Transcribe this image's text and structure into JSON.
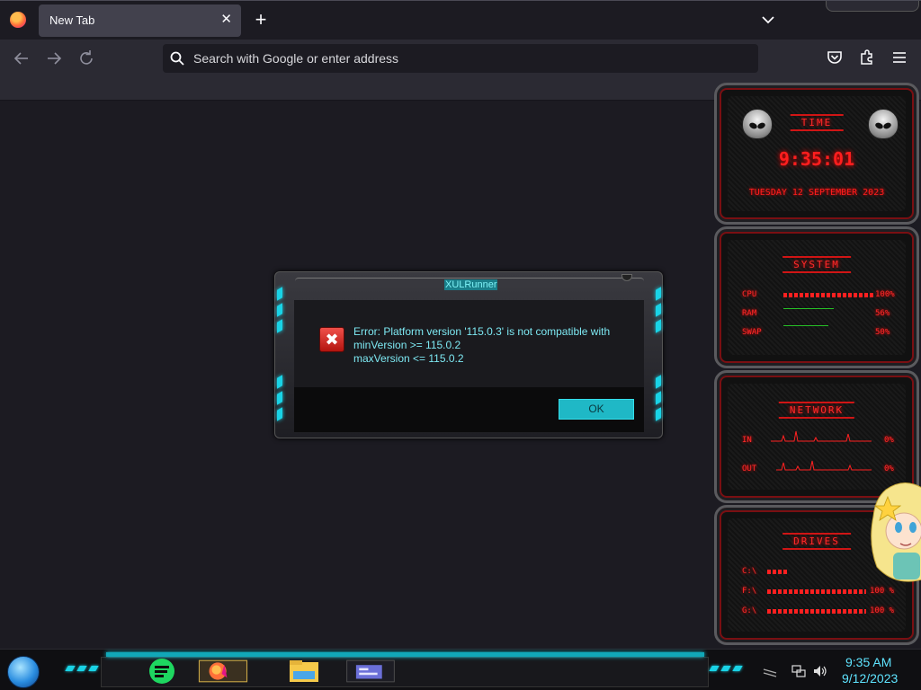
{
  "browser": {
    "tab": {
      "title": "New Tab",
      "close_glyph": "✕"
    },
    "new_tab_glyph": "+",
    "urlbar": {
      "placeholder": "Search with Google or enter address"
    },
    "icons": [
      "firefox-icon",
      "back-icon",
      "forward-icon",
      "reload-icon",
      "search-icon",
      "pocket-icon",
      "extensions-icon",
      "menu-icon",
      "list-all-tabs-icon"
    ]
  },
  "dialog": {
    "title": "XULRunner",
    "message_lines": [
      "Error: Platform version '115.0.3' is not compatible with",
      "minVersion >= 115.0.2",
      "maxVersion <= 115.0.2"
    ],
    "ok_label": "OK",
    "accent": "#19d3e6"
  },
  "gadgets": {
    "time": {
      "header": "TIME",
      "clock": "9:35:01",
      "date": "TUESDAY 12 SEPTEMBER 2023"
    },
    "system": {
      "header": "SYSTEM",
      "rows": [
        {
          "label": "CPU",
          "value": "100%",
          "level": 1.0
        },
        {
          "label": "RAM",
          "value": "56%",
          "level": 0.56
        },
        {
          "label": "SWAP",
          "value": "50%",
          "level": 0.5
        }
      ]
    },
    "network": {
      "header": "NETWORK",
      "rows": [
        {
          "label": "IN",
          "value": "0%"
        },
        {
          "label": "OUT",
          "value": "0%"
        }
      ]
    },
    "drives": {
      "header": "DRIVES",
      "rows": [
        {
          "label": "C:\\",
          "value": ""
        },
        {
          "label": "F:\\",
          "value": "100 %"
        },
        {
          "label": "G:\\",
          "value": "100 %"
        }
      ]
    },
    "accent": "#ff1e1e"
  },
  "taskbar": {
    "clock_time": "9:35 AM",
    "clock_date": "9/12/2023",
    "apps": [
      "spotify-icon",
      "firefox-icon",
      "file-explorer-icon",
      "control-panel-icon"
    ],
    "tray": [
      "network-icon",
      "volume-icon"
    ],
    "accent": "#5fe4ff"
  }
}
